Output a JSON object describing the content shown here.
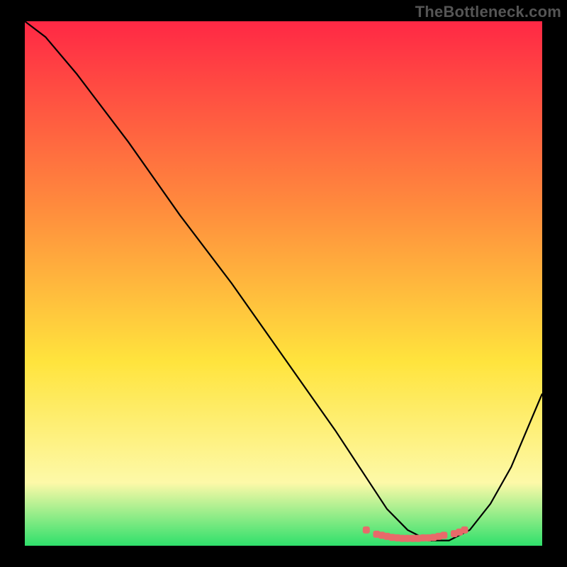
{
  "watermark": "TheBottleneck.com",
  "chart_data": {
    "type": "line",
    "xlabel": "",
    "ylabel": "",
    "xlim": [
      0,
      100
    ],
    "ylim": [
      0,
      100
    ],
    "bg_gradient": {
      "top": "#ff2845",
      "mid1": "#ff8a3d",
      "mid2": "#ffe43d",
      "mid3": "#fdf9a8",
      "bottom": "#2fe06b"
    },
    "series": [
      {
        "name": "curve",
        "color": "#000000",
        "stroke_width": 2.2,
        "x": [
          0,
          4,
          10,
          20,
          30,
          40,
          50,
          60,
          66,
          70,
          74,
          78,
          82,
          86,
          90,
          94,
          100
        ],
        "y": [
          100,
          97,
          90,
          77,
          63,
          50,
          36,
          22,
          13,
          7,
          3,
          1,
          1,
          3,
          8,
          15,
          29
        ]
      }
    ],
    "scatter": {
      "name": "min_zone_markers",
      "color": "#e86a6a",
      "size": 10,
      "x": [
        66,
        68,
        69,
        70,
        71,
        72,
        73,
        74,
        75,
        76,
        77,
        78,
        79,
        80,
        81,
        83,
        84,
        85
      ],
      "y": [
        3,
        2.2,
        2,
        1.8,
        1.6,
        1.5,
        1.4,
        1.4,
        1.4,
        1.4,
        1.5,
        1.5,
        1.6,
        1.8,
        2,
        2.3,
        2.6,
        3
      ]
    }
  }
}
